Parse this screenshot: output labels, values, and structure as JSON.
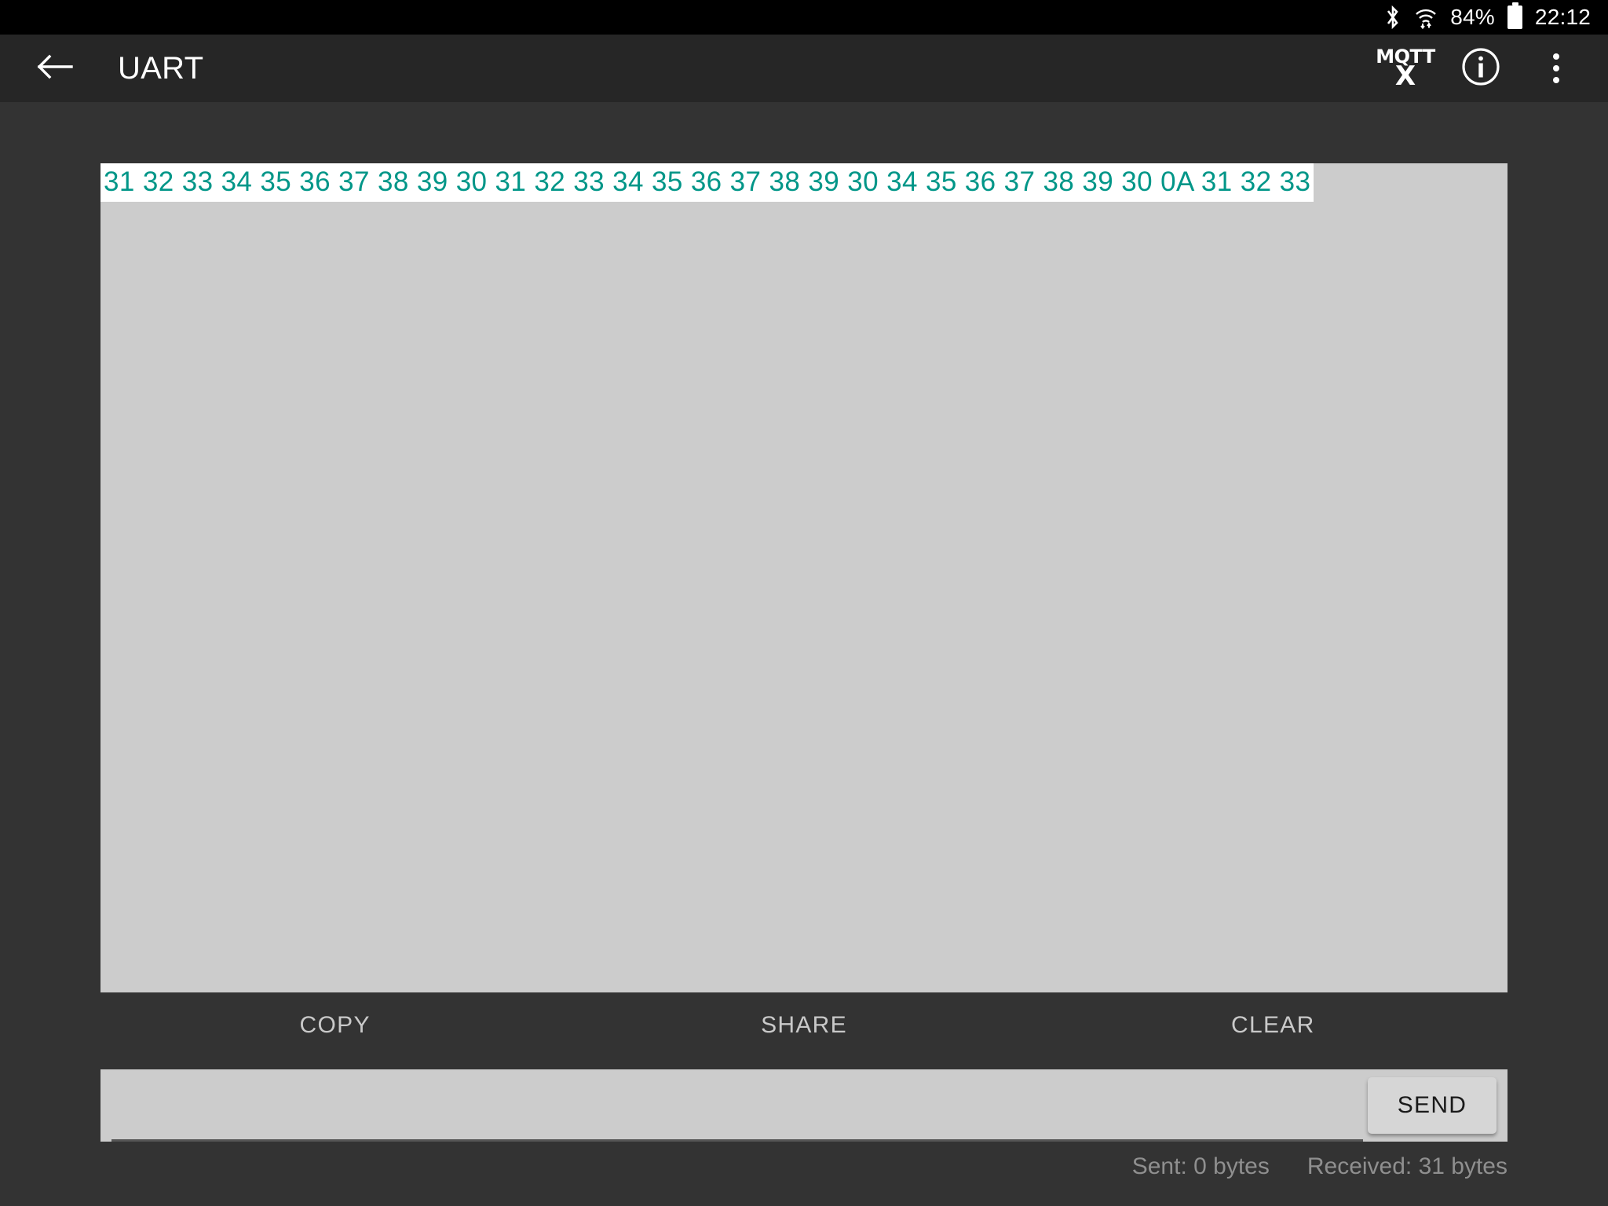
{
  "status_bar": {
    "bluetooth_icon": "bluetooth-icon",
    "wifi_icon": "wifi-icon",
    "battery_percent": "84%",
    "battery_icon": "battery-icon",
    "clock": "22:12"
  },
  "app_bar": {
    "back_icon": "back-arrow-icon",
    "title": "UART",
    "mqtt_logo_top": "MQTT",
    "mqtt_logo_bottom": "X",
    "info_icon": "info-icon",
    "overflow_icon": "overflow-menu-icon"
  },
  "terminal": {
    "line": "31 32 33 34 35 36 37 38 39 30 31 32 33 34 35 36 37 38 39 30 34 35 36 37 38 39 30 0A 31 32 33",
    "text_color": "#009688",
    "highlight_color": "#ffffff",
    "background_color": "#cccccc"
  },
  "actions": {
    "copy_label": "COPY",
    "share_label": "SHARE",
    "clear_label": "CLEAR"
  },
  "send": {
    "input_value": "",
    "input_placeholder": "",
    "send_label": "SEND"
  },
  "footer": {
    "sent": "Sent: 0 bytes",
    "received": "Received: 31 bytes"
  }
}
